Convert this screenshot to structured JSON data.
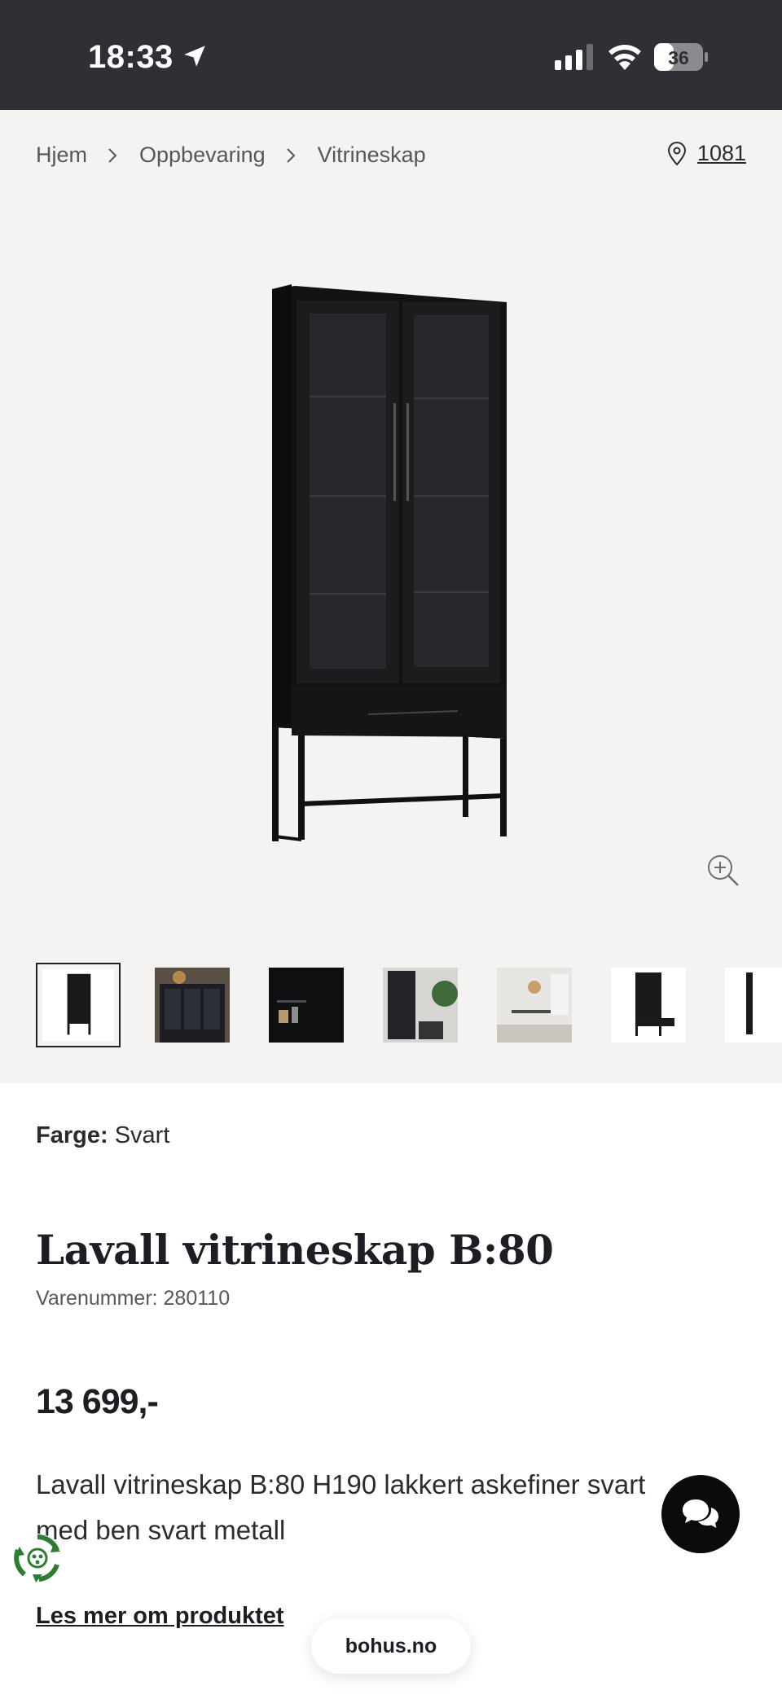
{
  "status_bar": {
    "time": "18:33",
    "battery": "36"
  },
  "breadcrumb": {
    "items": [
      "Hjem",
      "Oppbevaring",
      "Vitrineskap"
    ]
  },
  "store": {
    "code": "1081"
  },
  "gallery": {
    "thumbnail_count": 7,
    "active_index": 0
  },
  "product": {
    "color_label": "Farge:",
    "color_value": "Svart",
    "title": "Lavall vitrineskap B:80",
    "sku": "Varenummer: 280110",
    "price": "13 699,-",
    "description": "Lavall vitrineskap B:80 H190 lakkert askefiner svart med ben svart metall",
    "read_more": "Les mer om produktet"
  },
  "browser": {
    "url": "bohus.no"
  },
  "icons": {
    "location": "location-arrow-icon",
    "signal": "signal-icon",
    "wifi": "wifi-icon",
    "battery": "battery-icon",
    "chevron": "chevron-right-icon",
    "pin": "map-pin-icon",
    "zoom": "zoom-in-icon",
    "chat": "chat-icon",
    "eco": "recycle-icon"
  },
  "colors": {
    "status_bar": "#2f3035",
    "hero_bg": "#f5f3f1",
    "text": "#1f2126",
    "chat_button": "#0b0b0c",
    "eco_green": "#2e7d32"
  }
}
